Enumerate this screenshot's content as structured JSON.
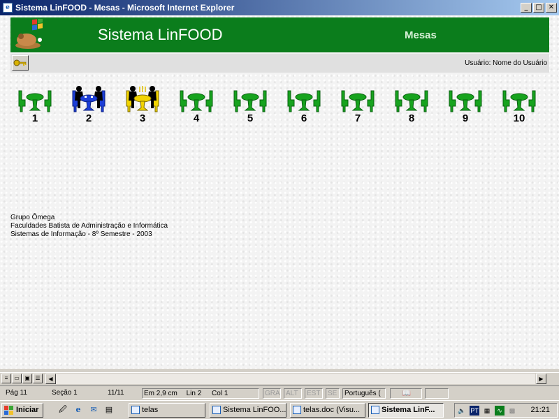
{
  "window": {
    "title": "Sistema LinFOOD - Mesas - Microsoft Internet Explorer",
    "min_glyph": "_",
    "max_glyph": "□",
    "close_glyph": "✕"
  },
  "header": {
    "system_title": "Sistema LinFOOD",
    "page_title": "Mesas",
    "bg_color": "#0b7d1c"
  },
  "subbar": {
    "user_label": "Usuário: Nome do Usuário"
  },
  "tables": [
    {
      "number": "1",
      "status": "free"
    },
    {
      "number": "2",
      "status": "occupied"
    },
    {
      "number": "3",
      "status": "served"
    },
    {
      "number": "4",
      "status": "free"
    },
    {
      "number": "5",
      "status": "free"
    },
    {
      "number": "6",
      "status": "free"
    },
    {
      "number": "7",
      "status": "free"
    },
    {
      "number": "8",
      "status": "free"
    },
    {
      "number": "9",
      "status": "free"
    },
    {
      "number": "10",
      "status": "free"
    }
  ],
  "footer": {
    "line1": "Grupo Ômega",
    "line2": "Faculdades Batista de Administração e Informática",
    "line3": "Sistemas de Informação - 8º Semestre - 2003"
  },
  "statusbar": {
    "page": "Pág  11",
    "section": "Seção  1",
    "pages": "11/11",
    "position": "Em  2,9 cm",
    "line": "Lin  2",
    "column": "Col  1",
    "gra": "GRA",
    "alt": "ALT",
    "est": "EST",
    "se": "SE",
    "language": "Português ("
  },
  "taskbar": {
    "start_label": "Iniciar",
    "tasks": [
      {
        "label": "telas"
      },
      {
        "label": "Sistema LinFOO..."
      },
      {
        "label": "telas.doc (Visu..."
      },
      {
        "label": "Sistema LinF..."
      }
    ],
    "tray_lang": "PT",
    "clock": "21:21"
  }
}
